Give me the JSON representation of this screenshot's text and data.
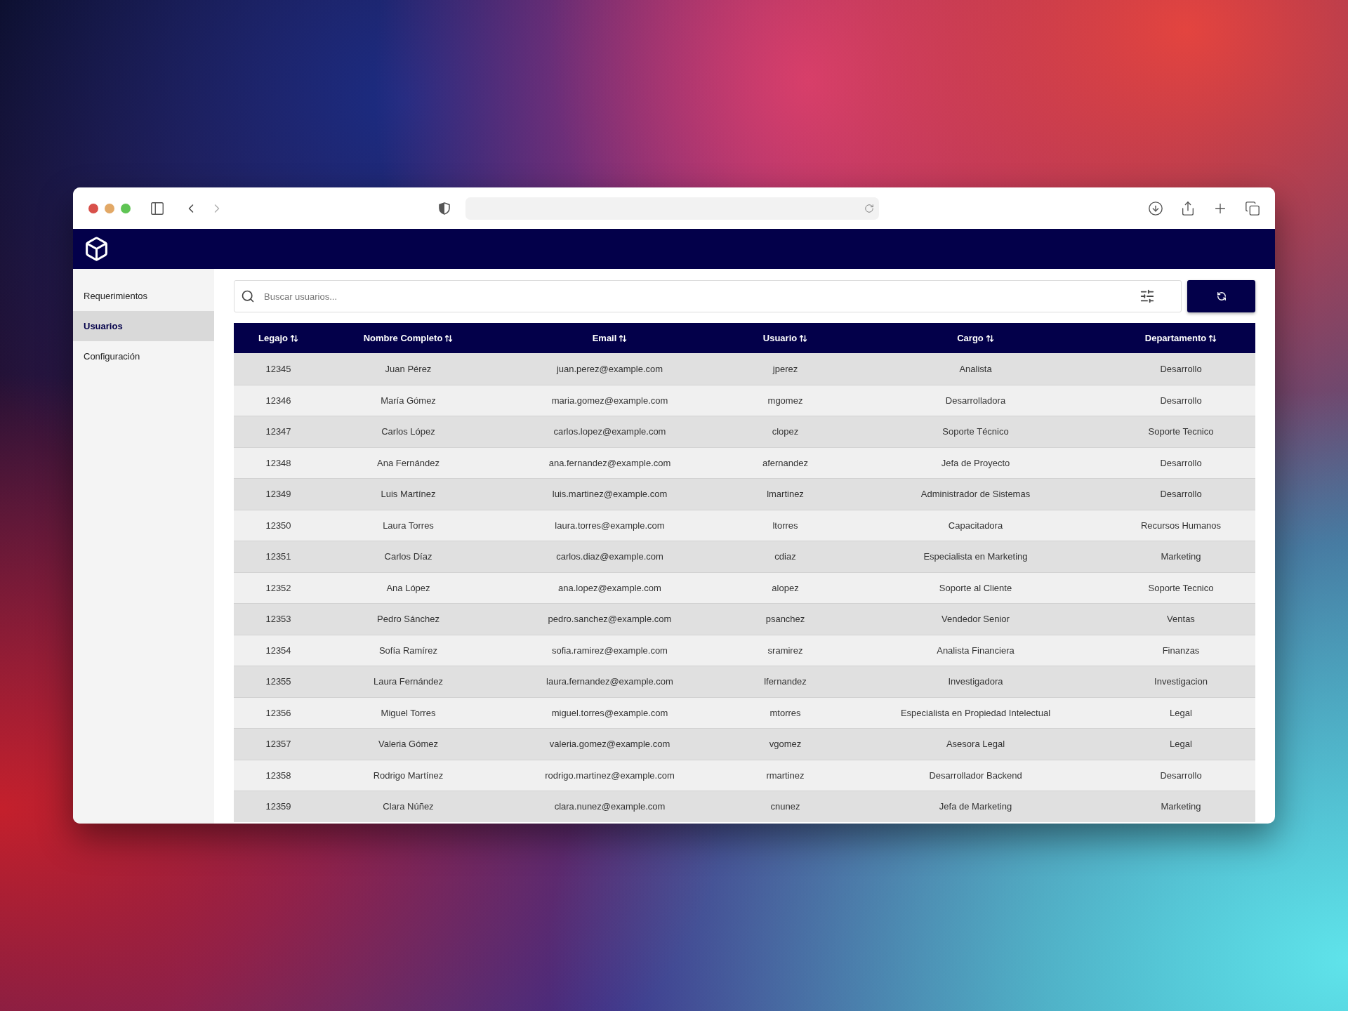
{
  "browser": {
    "back": {
      "disabled": false
    },
    "forward": {
      "disabled": true
    }
  },
  "sidebar": {
    "items": [
      {
        "label": "Requerimientos",
        "selected": false
      },
      {
        "label": "Usuarios",
        "selected": true
      },
      {
        "label": "Configuración",
        "selected": false
      }
    ]
  },
  "search": {
    "placeholder": "Buscar usuarios..."
  },
  "table": {
    "columns": [
      {
        "label": "Legajo",
        "sortable": true
      },
      {
        "label": "Nombre Completo",
        "sortable": true
      },
      {
        "label": "Email",
        "sortable": true
      },
      {
        "label": "Usuario",
        "sortable": true
      },
      {
        "label": "Cargo",
        "sortable": true
      },
      {
        "label": "Departamento",
        "sortable": true
      }
    ],
    "rows": [
      [
        "12345",
        "Juan Pérez",
        "juan.perez@example.com",
        "jperez",
        "Analista",
        "Desarrollo"
      ],
      [
        "12346",
        "María Gómez",
        "maria.gomez@example.com",
        "mgomez",
        "Desarrolladora",
        "Desarrollo"
      ],
      [
        "12347",
        "Carlos López",
        "carlos.lopez@example.com",
        "clopez",
        "Soporte Técnico",
        "Soporte Tecnico"
      ],
      [
        "12348",
        "Ana Fernández",
        "ana.fernandez@example.com",
        "afernandez",
        "Jefa de Proyecto",
        "Desarrollo"
      ],
      [
        "12349",
        "Luis Martínez",
        "luis.martinez@example.com",
        "lmartinez",
        "Administrador de Sistemas",
        "Desarrollo"
      ],
      [
        "12350",
        "Laura Torres",
        "laura.torres@example.com",
        "ltorres",
        "Capacitadora",
        "Recursos Humanos"
      ],
      [
        "12351",
        "Carlos Díaz",
        "carlos.diaz@example.com",
        "cdiaz",
        "Especialista en Marketing",
        "Marketing"
      ],
      [
        "12352",
        "Ana López",
        "ana.lopez@example.com",
        "alopez",
        "Soporte al Cliente",
        "Soporte Tecnico"
      ],
      [
        "12353",
        "Pedro Sánchez",
        "pedro.sanchez@example.com",
        "psanchez",
        "Vendedor Senior",
        "Ventas"
      ],
      [
        "12354",
        "Sofía Ramírez",
        "sofia.ramirez@example.com",
        "sramirez",
        "Analista Financiera",
        "Finanzas"
      ],
      [
        "12355",
        "Laura Fernández",
        "laura.fernandez@example.com",
        "lfernandez",
        "Investigadora",
        "Investigacion"
      ],
      [
        "12356",
        "Miguel Torres",
        "miguel.torres@example.com",
        "mtorres",
        "Especialista en Propiedad Intelectual",
        "Legal"
      ],
      [
        "12357",
        "Valeria Gómez",
        "valeria.gomez@example.com",
        "vgomez",
        "Asesora Legal",
        "Legal"
      ],
      [
        "12358",
        "Rodrigo Martínez",
        "rodrigo.martinez@example.com",
        "rmartinez",
        "Desarrollador Backend",
        "Desarrollo"
      ],
      [
        "12359",
        "Clara Núñez",
        "clara.nunez@example.com",
        "cnunez",
        "Jefa de Marketing",
        "Marketing"
      ]
    ]
  }
}
